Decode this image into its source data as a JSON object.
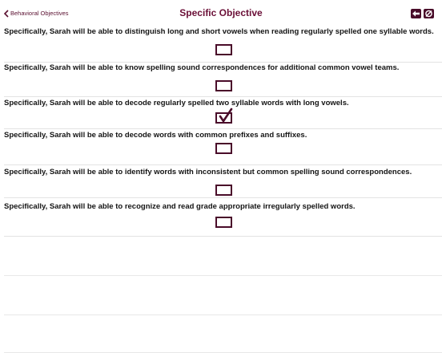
{
  "nav": {
    "back_label": "Behavioral Objectives",
    "title": "Specific Objective",
    "back_arrow_icon": "back-arrow-icon",
    "tool_icon": "tool-icon"
  },
  "colors": {
    "accent": "#6a0e36",
    "checkbox_border": "#4a0d2a"
  },
  "objectives": [
    {
      "text": "Specifically, Sarah will be able to distinguish long and short vowels when reading regularly spelled one syllable words.",
      "checked": false
    },
    {
      "text": "Specifically, Sarah will be able to know spelling sound correspondences for additional common vowel teams.",
      "checked": false
    },
    {
      "text": "Specifically, Sarah will be able to decode regularly spelled two syllable words with long vowels.",
      "checked": true
    },
    {
      "text": "Specifically, Sarah will be able to decode words with common prefixes and suffixes.",
      "checked": false
    },
    {
      "text": "Specifically, Sarah will be able to identify words with inconsistent but common spelling sound correspondences.",
      "checked": false
    },
    {
      "text": "Specifically, Sarah will be able to recognize and read grade appropriate irregularly spelled words.",
      "checked": false
    }
  ]
}
